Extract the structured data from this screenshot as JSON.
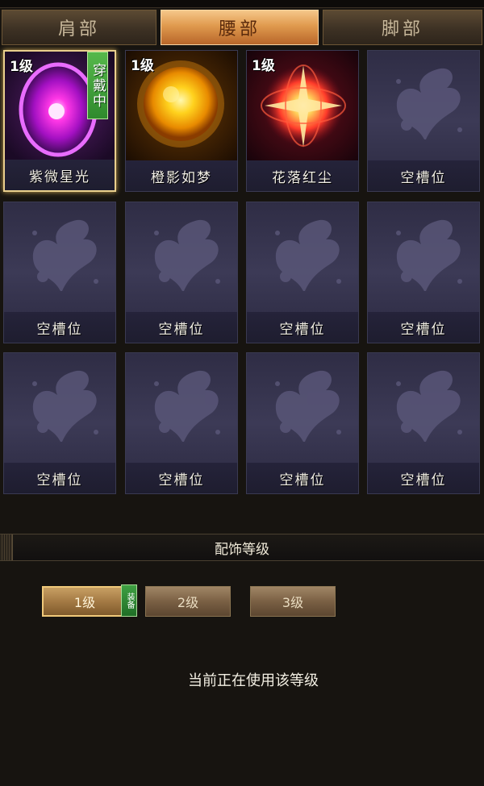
{
  "tabs": [
    {
      "label": "肩部",
      "active": false
    },
    {
      "label": "腰部",
      "active": true
    },
    {
      "label": "脚部",
      "active": false
    }
  ],
  "slots": [
    {
      "level": "1级",
      "name": "紫微星光",
      "icon": "purple-orb-icon",
      "selected": true,
      "wearing_tag": "穿戴中"
    },
    {
      "level": "1级",
      "name": "橙影如梦",
      "icon": "golden-sun-icon"
    },
    {
      "level": "1级",
      "name": "花落红尘",
      "icon": "red-starburst-icon"
    },
    {
      "name": "空槽位",
      "icon": "butterfly-icon"
    },
    {
      "name": "空槽位",
      "icon": "butterfly-icon"
    },
    {
      "name": "空槽位",
      "icon": "butterfly-icon"
    },
    {
      "name": "空槽位",
      "icon": "butterfly-icon"
    },
    {
      "name": "空槽位",
      "icon": "butterfly-icon"
    },
    {
      "name": "空槽位",
      "icon": "butterfly-icon"
    },
    {
      "name": "空槽位",
      "icon": "butterfly-icon"
    },
    {
      "name": "空槽位",
      "icon": "butterfly-icon"
    },
    {
      "name": "空槽位",
      "icon": "butterfly-icon"
    }
  ],
  "accessory_level": {
    "title": "配饰等级",
    "buttons": [
      {
        "label": "1级",
        "active": true,
        "badge": "装备"
      },
      {
        "label": "2级",
        "active": false
      },
      {
        "label": "3级",
        "active": false
      }
    ],
    "status": "当前正在使用该等级"
  },
  "colors": {
    "tab_active": "#e09a4e",
    "slot_bg": "#3c3a56",
    "selected_border": "#e9cf8d",
    "wearing_green": "#2f8a2d"
  }
}
